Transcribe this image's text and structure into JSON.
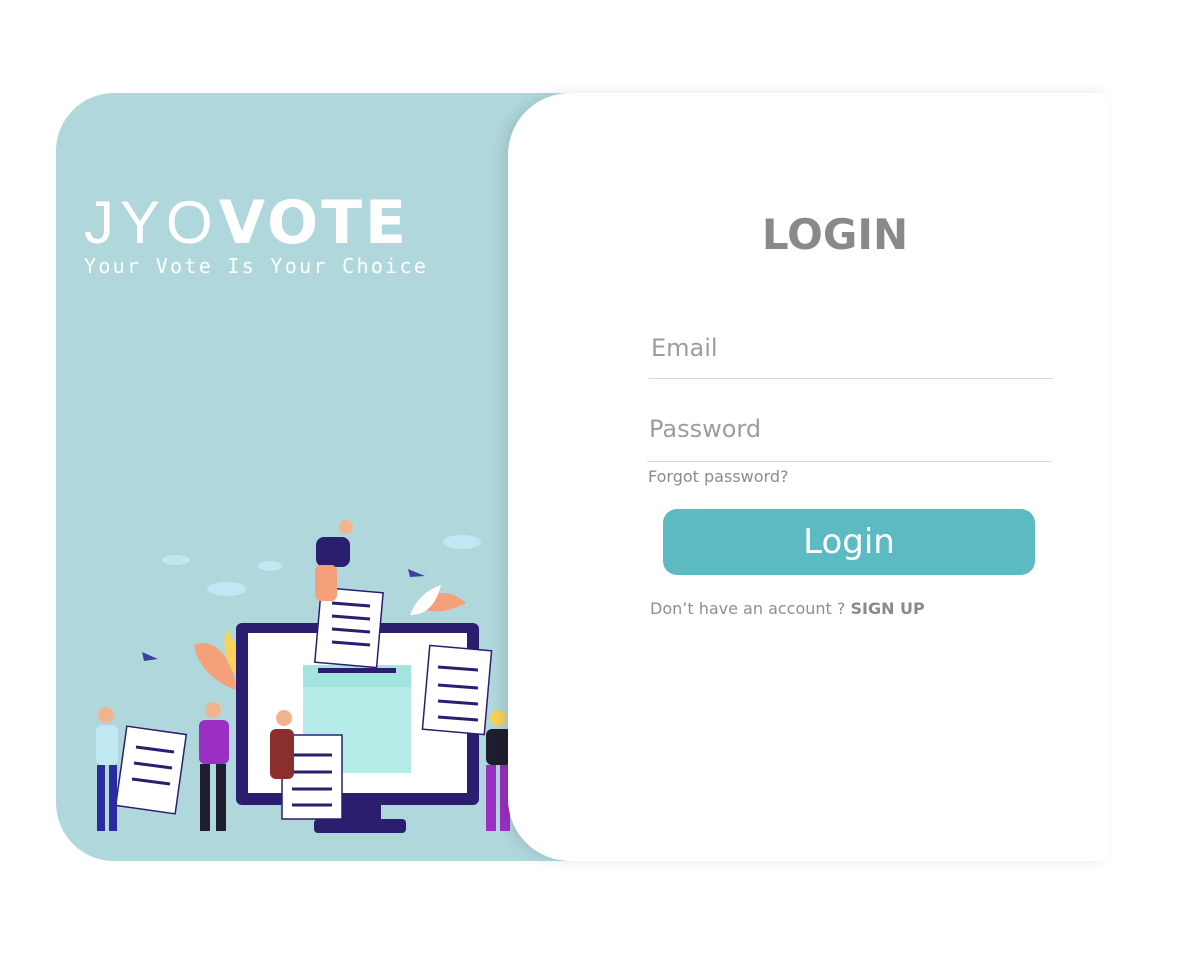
{
  "brand": {
    "name_light": "JYO",
    "name_bold": "VOTE",
    "tagline": "Your Vote Is Your Choice"
  },
  "login": {
    "title": "LOGIN",
    "email_placeholder": "Email",
    "email_value": "",
    "password_placeholder": "Password",
    "password_value": "",
    "forgot_label": "Forgot password?",
    "button_label": "Login",
    "signup_prompt": "Don’t have an account ?",
    "signup_label": "SIGN UP"
  },
  "colors": {
    "panel_bg": "#b0d8dc",
    "accent": "#5cbac2",
    "title": "#8a8888",
    "monitor": "#2b1e6e"
  },
  "illustration": {
    "subject": "people-voting-around-computer-ballot-box"
  }
}
